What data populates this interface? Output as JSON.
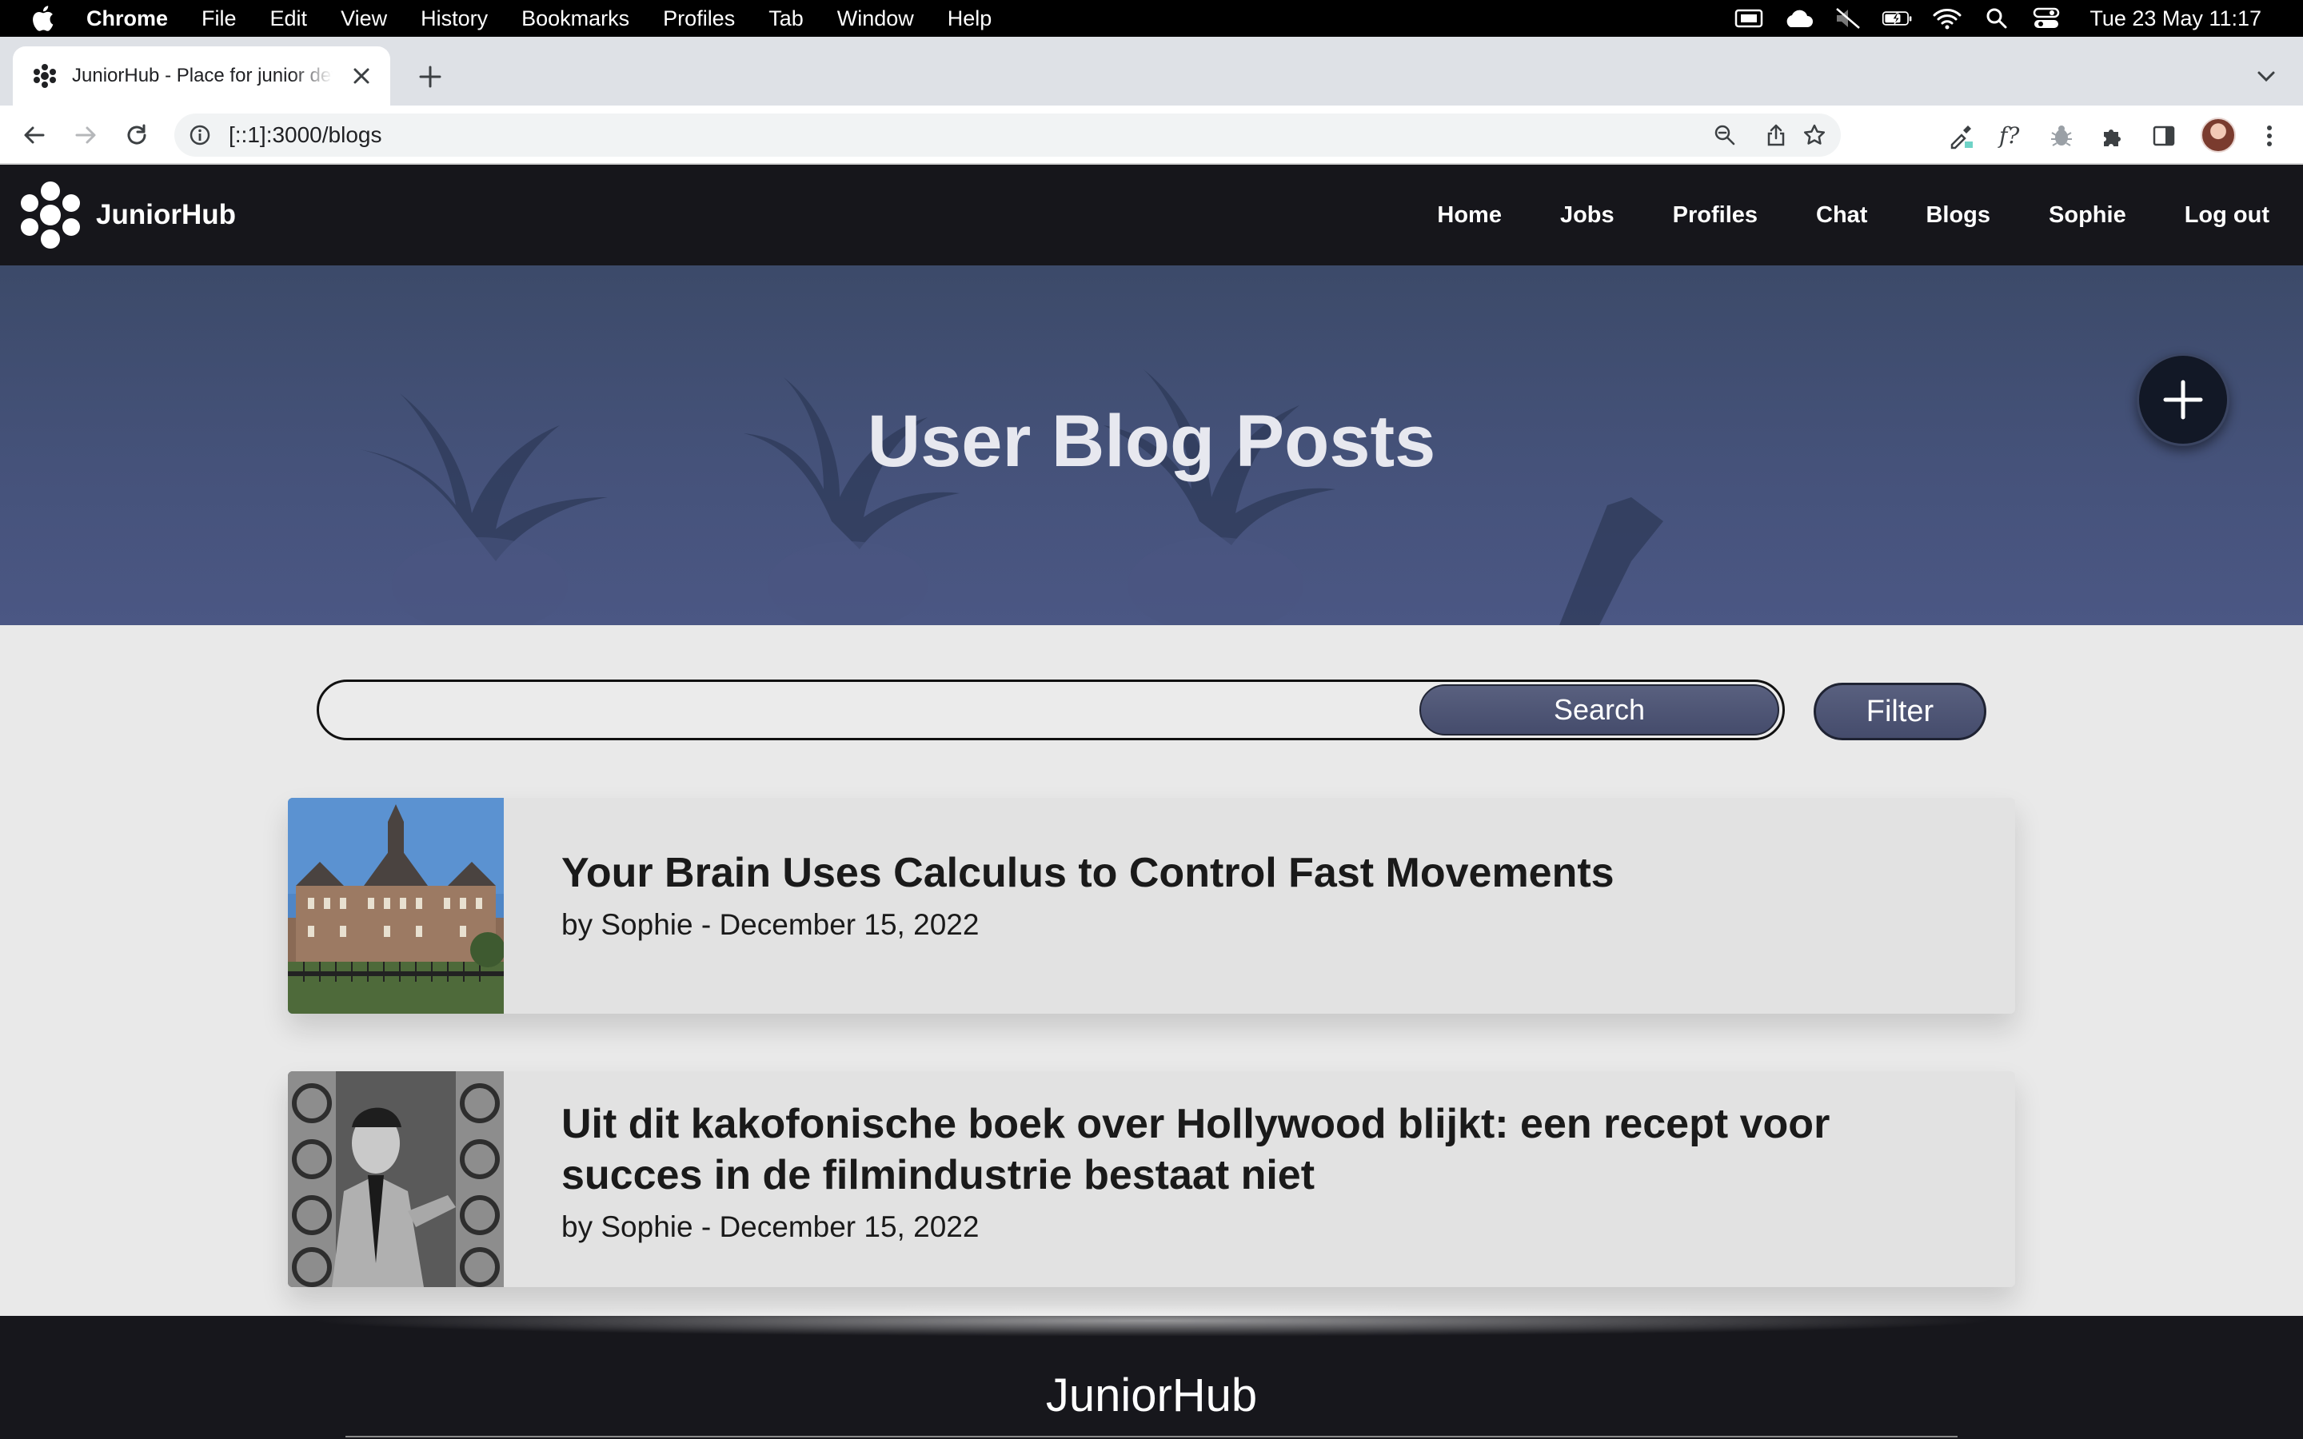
{
  "menubar": {
    "app": "Chrome",
    "items": [
      "File",
      "Edit",
      "View",
      "History",
      "Bookmarks",
      "Profiles",
      "Tab",
      "Window",
      "Help"
    ],
    "clock": "Tue 23 May  11:17"
  },
  "browser": {
    "tab_title": "JuniorHub - Place for junior developers",
    "url": "[::1]:3000/blogs"
  },
  "site": {
    "brand": "JuniorHub",
    "nav": [
      "Home",
      "Jobs",
      "Profiles",
      "Chat",
      "Blogs",
      "Sophie",
      "Log out"
    ]
  },
  "hero": {
    "title": "User Blog Posts"
  },
  "search": {
    "placeholder": "",
    "button_label": "Search",
    "filter_label": "Filter"
  },
  "posts": [
    {
      "title": "Your Brain Uses Calculus to Control Fast Movements",
      "meta": "by Sophie - December 15, 2022",
      "image": "palace-photo"
    },
    {
      "title": "Uit dit kakofonische boek over Hollywood blijkt: een recept voor succes in de filmindustrie bestaat niet",
      "meta": "by Sophie - December 15, 2022",
      "image": "film-archive-portrait-photo"
    }
  ],
  "footer": {
    "brand": "JuniorHub"
  },
  "colors": {
    "navbar": "#16161b",
    "hero": "#45527a",
    "button": "#4f5677",
    "page": "#e9e9e9"
  }
}
